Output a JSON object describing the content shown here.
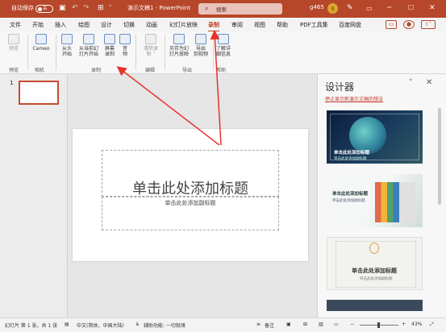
{
  "titlebar": {
    "autosave_label": "自动保存",
    "autosave_state": "关",
    "doc_title": "演示文稿1 - PowerPoint",
    "search_placeholder": "搜索",
    "user_name": "g465",
    "avatar_initial": "g",
    "accent_color": "#b7472a"
  },
  "tabs": [
    "文件",
    "开始",
    "插入",
    "绘图",
    "设计",
    "切换",
    "动画",
    "幻灯片放映",
    "录制",
    "审阅",
    "视图",
    "帮助",
    "PDF工具集",
    "百度网盘"
  ],
  "active_tab": "录制",
  "ribbon": {
    "preview": "预览",
    "cameo": "Cameo",
    "from_start": [
      "从头",
      "开始"
    ],
    "from_current": [
      "从当前幻",
      "灯片开始"
    ],
    "screen_record": [
      "屏幕",
      "录制"
    ],
    "audio": [
      "音",
      "频"
    ],
    "clear_rec": [
      "清除录",
      "制 ˅"
    ],
    "save_show": [
      "另存为幻",
      "灯片放映"
    ],
    "export_video": [
      "导出",
      "到视频"
    ],
    "learn_more": [
      "了解详",
      "细信息"
    ],
    "groups": [
      "预览",
      "相机",
      "录制",
      "编辑",
      "导出",
      "帮助"
    ]
  },
  "thumbnails": {
    "slide_number": "1"
  },
  "slide": {
    "title_placeholder": "单击此处添加标题",
    "subtitle_placeholder": "单击此处添加副标题"
  },
  "designer": {
    "title": "设计器",
    "stop_link": "停止显示新演示文稿的想法",
    "cards": [
      {
        "title": "单击此处添加标题",
        "sub": "单击此处添加副标题"
      },
      {
        "title": "单击此处添加标题",
        "sub": "单击此处添加副标题"
      },
      {
        "title": "单击此处添加标题",
        "sub": "单击此处添加副标题"
      }
    ]
  },
  "status": {
    "slide_info": "幻灯片 第 1 张，共 1 张",
    "language": "中文(简体，中国大陆)",
    "accessibility": "辅助功能: 一切就绪",
    "notes": "备注",
    "zoom": "43%"
  }
}
